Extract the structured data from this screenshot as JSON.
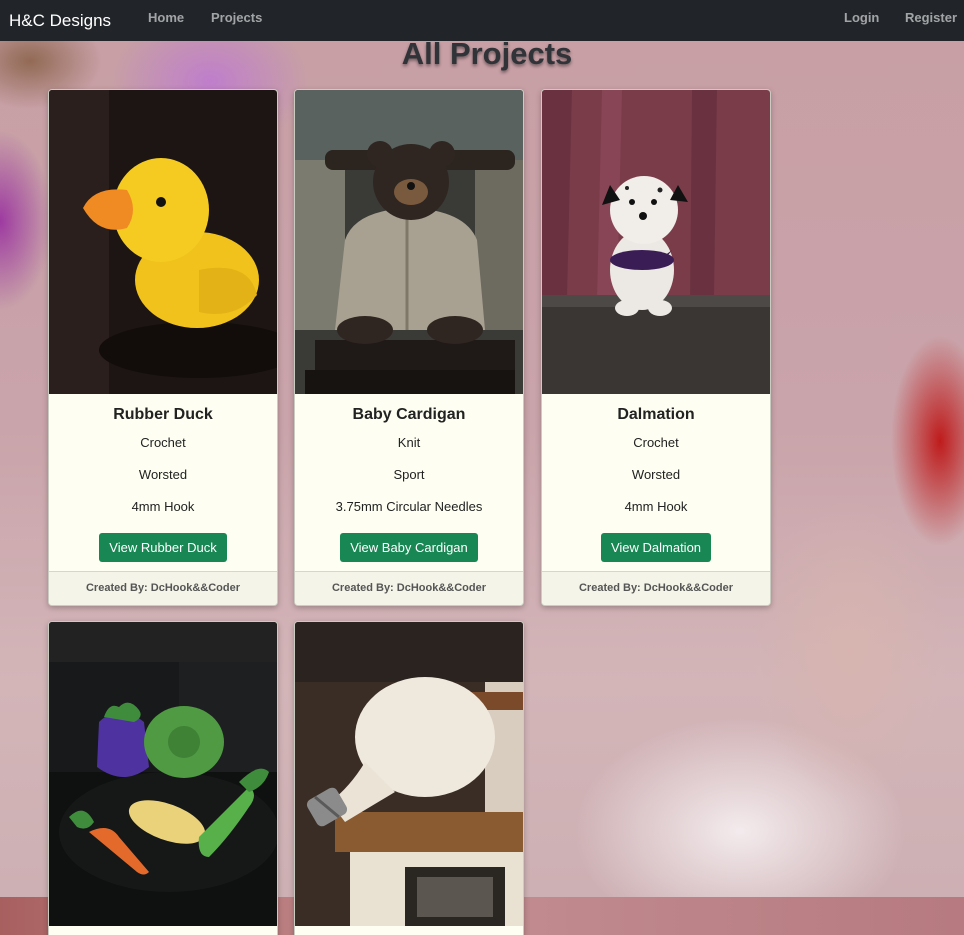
{
  "navbar": {
    "brand": "H&C Designs",
    "home": "Home",
    "projects": "Projects",
    "login": "Login",
    "register": "Register"
  },
  "page": {
    "title": "All Projects"
  },
  "projects": [
    {
      "title": "Rubber Duck",
      "craft": "Crochet",
      "yarn": "Worsted",
      "tool": "4mm Hook",
      "button": "View Rubber Duck",
      "footer": "Created By: DcHook&&Coder",
      "image": "yellow-crochet-duck"
    },
    {
      "title": "Baby Cardigan",
      "craft": "Knit",
      "yarn": "Sport",
      "tool": "3.75mm Circular Needles",
      "button": "View Baby Cardigan",
      "footer": "Created By: DcHook&&Coder",
      "image": "teddy-bear-in-cardigan"
    },
    {
      "title": "Dalmation",
      "craft": "Crochet",
      "yarn": "Worsted",
      "tool": "4mm Hook",
      "button": "View Dalmation",
      "footer": "Created By: DcHook&&Coder",
      "image": "crochet-dalmatian-puppy"
    },
    {
      "image": "crochet-vegetables"
    },
    {
      "image": "crochet-light-bulb"
    }
  ]
}
